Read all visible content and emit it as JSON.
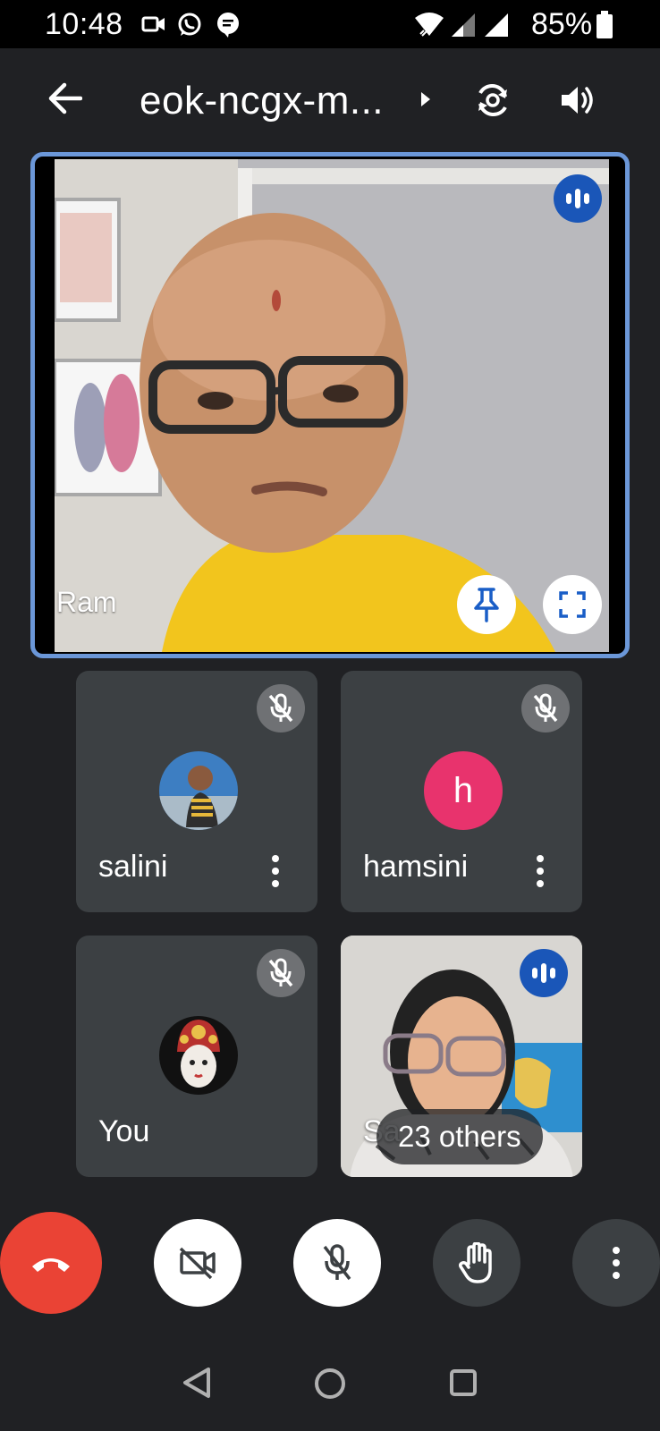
{
  "status_bar": {
    "time": "10:48",
    "battery": "85%",
    "icons": [
      "video-call-icon",
      "whatsapp-icon",
      "chat-bubble-icon",
      "wifi-icon",
      "signal-icon",
      "signal-icon",
      "battery-icon"
    ]
  },
  "header": {
    "title": "eok-ncgx-m...",
    "icons": [
      "back-arrow-icon",
      "chevron-right-icon",
      "switch-camera-icon",
      "speaker-icon"
    ]
  },
  "main_tile": {
    "name": "Ram",
    "icons": [
      "speaking-indicator-icon",
      "pin-icon",
      "fullscreen-icon"
    ]
  },
  "participants": [
    {
      "name": "salini",
      "muted": true
    },
    {
      "name": "hamsini",
      "muted": true,
      "initial": "h",
      "avatar_color": "#e8336d"
    },
    {
      "name": "You",
      "muted": true
    },
    {
      "name": "Sa",
      "others_label": "23 others",
      "speaking": true
    }
  ],
  "controls": {
    "icons": [
      "end-call-icon",
      "camera-off-icon",
      "mic-off-icon",
      "raise-hand-icon",
      "more-options-icon"
    ],
    "end_call_color": "#ea4335"
  },
  "nav": {
    "icons": [
      "back-triangle-icon",
      "home-circle-icon",
      "recents-square-icon"
    ]
  },
  "colors": {
    "background": "#202124",
    "tile": "#3c4043",
    "accent_border": "#6b97d8",
    "speaking_badge": "#1a56b8"
  }
}
